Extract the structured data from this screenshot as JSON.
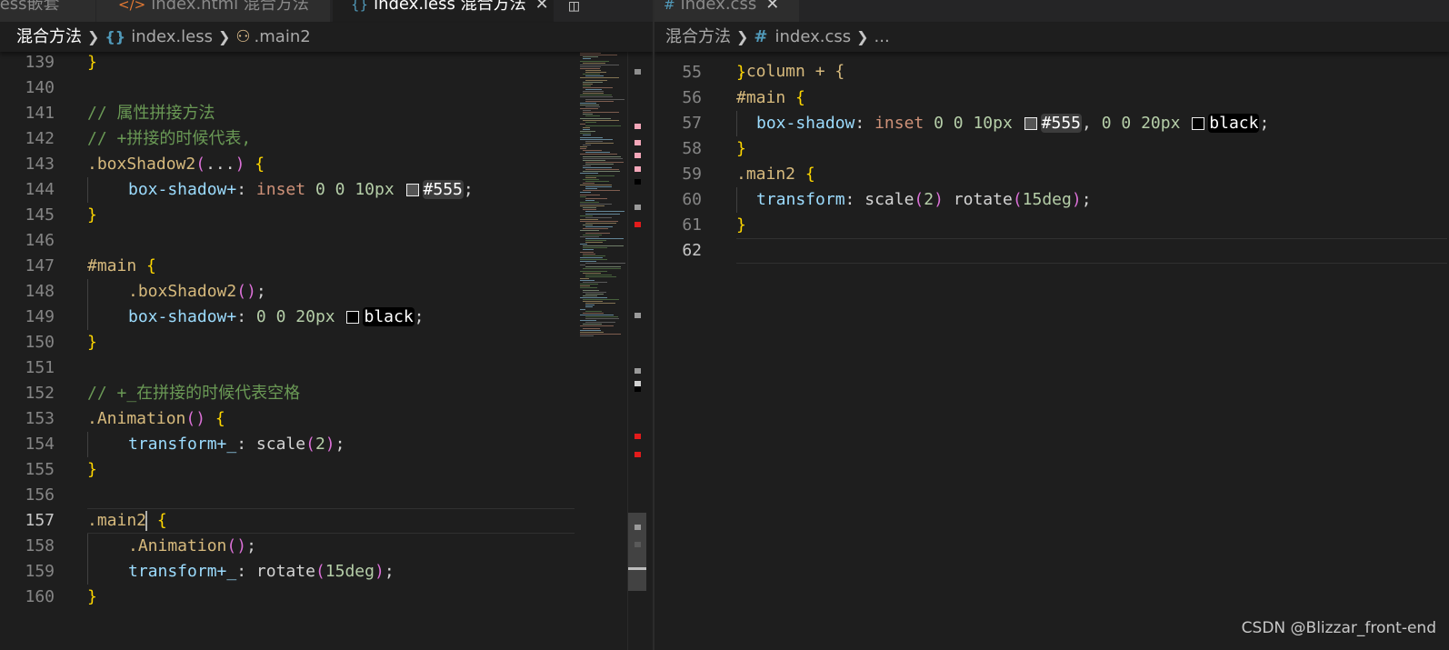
{
  "left_editor": {
    "tabs": [
      {
        "label": "Less嵌套",
        "icon": ""
      },
      {
        "label": "index.html 混合方法",
        "icon": "</>"
      },
      {
        "label": "index.less 混合方法",
        "icon": "{}"
      }
    ],
    "breadcrumb": {
      "folder": "混合方法",
      "file": "index.less",
      "symbol": ".main2"
    },
    "lines": [
      {
        "n": "139",
        "tokens": [
          [
            "brace",
            "}"
          ]
        ]
      },
      {
        "n": "140",
        "tokens": []
      },
      {
        "n": "141",
        "tokens": [
          [
            "comment",
            "// 属性拼接方法"
          ]
        ]
      },
      {
        "n": "142",
        "tokens": [
          [
            "comment",
            "// +拼接的时候代表,"
          ]
        ]
      },
      {
        "n": "143",
        "tokens": [
          [
            "sel",
            ".boxShadow2"
          ],
          [
            "paren",
            "("
          ],
          [
            "plain",
            "..."
          ],
          [
            "paren",
            ")"
          ],
          [
            "plain",
            " "
          ],
          [
            "brace",
            "{"
          ]
        ]
      },
      {
        "n": "144",
        "tokens": [
          [
            "prop",
            "box-shadow+"
          ],
          [
            "punct",
            ": "
          ],
          [
            "kw",
            "inset"
          ],
          [
            "plain",
            " "
          ],
          [
            "num",
            "0"
          ],
          [
            "plain",
            " "
          ],
          [
            "num",
            "0"
          ],
          [
            "plain",
            " "
          ],
          [
            "num",
            "10px"
          ],
          [
            "plain",
            " "
          ],
          [
            "color",
            "#555",
            "#555555",
            "#3c3c3c"
          ],
          [
            "punct",
            ";"
          ]
        ]
      },
      {
        "n": "145",
        "tokens": [
          [
            "brace",
            "}"
          ]
        ]
      },
      {
        "n": "146",
        "tokens": []
      },
      {
        "n": "147",
        "tokens": [
          [
            "sel",
            "#main"
          ],
          [
            "plain",
            " "
          ],
          [
            "brace",
            "{"
          ]
        ]
      },
      {
        "n": "148",
        "tokens": [
          [
            "sel",
            ".boxShadow2"
          ],
          [
            "paren",
            "("
          ],
          [
            "paren",
            ")"
          ],
          [
            "punct",
            ";"
          ]
        ]
      },
      {
        "n": "149",
        "tokens": [
          [
            "prop",
            "box-shadow+"
          ],
          [
            "punct",
            ": "
          ],
          [
            "num",
            "0"
          ],
          [
            "plain",
            " "
          ],
          [
            "num",
            "0"
          ],
          [
            "plain",
            " "
          ],
          [
            "num",
            "20px"
          ],
          [
            "plain",
            " "
          ],
          [
            "color",
            "black",
            "#000000",
            "#000000"
          ],
          [
            "punct",
            ";"
          ]
        ]
      },
      {
        "n": "150",
        "tokens": [
          [
            "brace",
            "}"
          ]
        ]
      },
      {
        "n": "151",
        "tokens": []
      },
      {
        "n": "152",
        "tokens": [
          [
            "comment",
            "// +_在拼接的时候代表空格"
          ]
        ]
      },
      {
        "n": "153",
        "tokens": [
          [
            "sel",
            ".Animation"
          ],
          [
            "paren",
            "("
          ],
          [
            "paren",
            ")"
          ],
          [
            "plain",
            " "
          ],
          [
            "brace",
            "{"
          ]
        ]
      },
      {
        "n": "154",
        "tokens": [
          [
            "prop",
            "transform+_"
          ],
          [
            "punct",
            ": "
          ],
          [
            "plain",
            "scale"
          ],
          [
            "paren",
            "("
          ],
          [
            "num",
            "2"
          ],
          [
            "paren",
            ")"
          ],
          [
            "punct",
            ";"
          ]
        ]
      },
      {
        "n": "155",
        "tokens": [
          [
            "brace",
            "}"
          ]
        ]
      },
      {
        "n": "156",
        "tokens": []
      },
      {
        "n": "157",
        "tokens": [
          [
            "sel",
            ".main2"
          ],
          [
            "cursor",
            ""
          ],
          [
            "plain",
            " "
          ],
          [
            "brace",
            "{"
          ]
        ]
      },
      {
        "n": "158",
        "tokens": [
          [
            "sel",
            ".Animation"
          ],
          [
            "paren",
            "("
          ],
          [
            "paren",
            ")"
          ],
          [
            "punct",
            ";"
          ]
        ]
      },
      {
        "n": "159",
        "tokens": [
          [
            "prop",
            "transform+_"
          ],
          [
            "punct",
            ": "
          ],
          [
            "plain",
            "rotate"
          ],
          [
            "paren",
            "("
          ],
          [
            "num",
            "15deg"
          ],
          [
            "paren",
            ")"
          ],
          [
            "punct",
            ";"
          ]
        ]
      },
      {
        "n": "160",
        "tokens": [
          [
            "brace",
            "}"
          ]
        ]
      }
    ]
  },
  "right_editor": {
    "tabs": [
      {
        "label": "index.css",
        "icon": "#"
      }
    ],
    "breadcrumb": {
      "folder": "混合方法",
      "file": "index.css",
      "more": "..."
    },
    "lines": [
      {
        "n": "55",
        "tokens": [
          [
            "brace",
            "}"
          ]
        ]
      },
      {
        "n": "56",
        "tokens": [
          [
            "sel",
            "#main"
          ],
          [
            "plain",
            " "
          ],
          [
            "brace",
            "{"
          ]
        ]
      },
      {
        "n": "57",
        "tokens": [
          [
            "prop",
            "box-shadow"
          ],
          [
            "punct",
            ": "
          ],
          [
            "kw",
            "inset"
          ],
          [
            "plain",
            " "
          ],
          [
            "num",
            "0"
          ],
          [
            "plain",
            " "
          ],
          [
            "num",
            "0"
          ],
          [
            "plain",
            " "
          ],
          [
            "num",
            "10px"
          ],
          [
            "plain",
            " "
          ],
          [
            "color",
            "#555",
            "#555555",
            "#3c3c3c"
          ],
          [
            "punct",
            ", "
          ],
          [
            "num",
            "0"
          ],
          [
            "plain",
            " "
          ],
          [
            "num",
            "0"
          ],
          [
            "plain",
            " "
          ],
          [
            "num",
            "20px"
          ],
          [
            "plain",
            " "
          ],
          [
            "color",
            "black",
            "#000000",
            "#000000"
          ],
          [
            "punct",
            ";"
          ]
        ]
      },
      {
        "n": "58",
        "tokens": [
          [
            "brace",
            "}"
          ]
        ]
      },
      {
        "n": "59",
        "tokens": [
          [
            "sel",
            ".main2"
          ],
          [
            "plain",
            " "
          ],
          [
            "brace",
            "{"
          ]
        ]
      },
      {
        "n": "60",
        "tokens": [
          [
            "prop",
            "transform"
          ],
          [
            "punct",
            ": "
          ],
          [
            "plain",
            "scale"
          ],
          [
            "paren",
            "("
          ],
          [
            "num",
            "2"
          ],
          [
            "paren",
            ")"
          ],
          [
            "plain",
            " rotate"
          ],
          [
            "paren",
            "("
          ],
          [
            "num",
            "15deg"
          ],
          [
            "paren",
            ")"
          ],
          [
            "punct",
            ";"
          ]
        ]
      },
      {
        "n": "61",
        "tokens": [
          [
            "brace",
            "}"
          ]
        ]
      },
      {
        "n": "62",
        "tokens": []
      }
    ]
  },
  "watermark": "CSDN @Blizzar_front-end",
  "colors": {
    "background": "#1e1e1e",
    "selector": "#d7ba7d",
    "property": "#9cdcfe",
    "number": "#b5cea8",
    "keyword": "#ce9178",
    "comment": "#6a9955",
    "brace": "#ffd700",
    "paren": "#da70d6"
  },
  "icons": [
    "close-icon",
    "split-editor-icon",
    "less-file-icon",
    "css-file-icon",
    "chevron-right-icon",
    "symbol-class-icon"
  ]
}
